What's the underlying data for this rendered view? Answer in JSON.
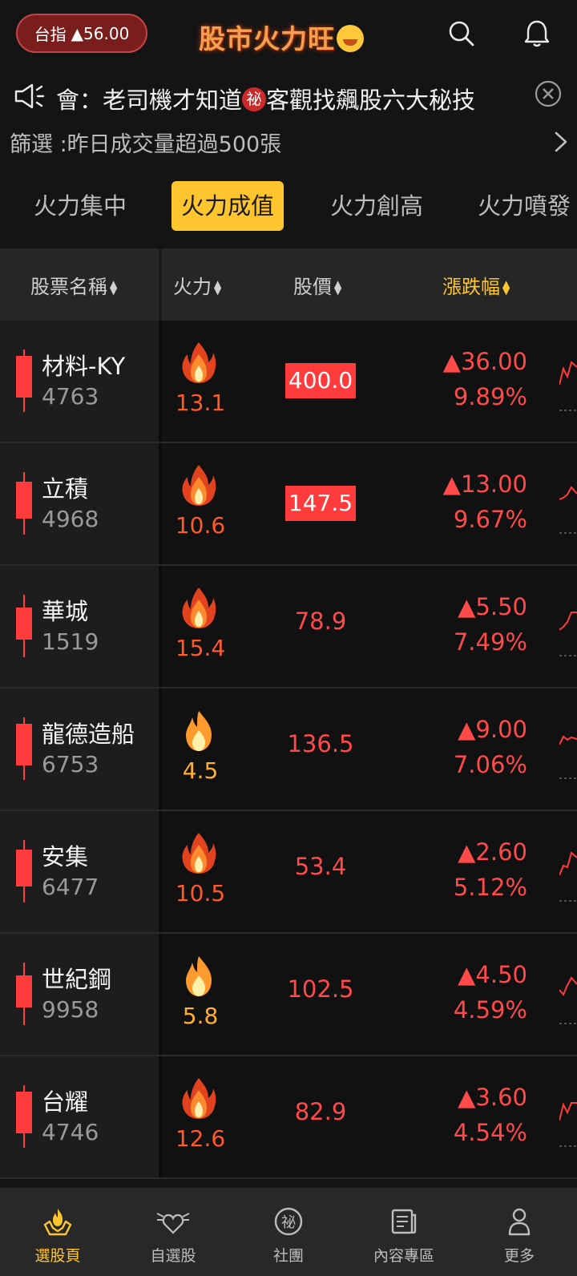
{
  "header": {
    "index_label": "台指",
    "index_change": "▲56.00",
    "app_title": "股市火力旺"
  },
  "announcement": {
    "text_before": "會：老司機才知道",
    "badge": "祕",
    "text_after": "客觀找飆股六大秘技"
  },
  "filter": {
    "text": "篩選 :昨日成交量超過500張"
  },
  "tabs": [
    {
      "label": "火力集中",
      "active": false
    },
    {
      "label": "火力成值",
      "active": true
    },
    {
      "label": "火力創高",
      "active": false
    },
    {
      "label": "火力噴發",
      "active": false
    }
  ],
  "table": {
    "headers": {
      "name": "股票名稱",
      "fire": "火力",
      "price": "股價",
      "change": "漲跌幅"
    },
    "rows": [
      {
        "name": "材料-KY",
        "code": "4763",
        "fire": "13.1",
        "price": "400.0",
        "limit_up": true,
        "change": "▲36.00",
        "pct": "9.89%"
      },
      {
        "name": "立積",
        "code": "4968",
        "fire": "10.6",
        "price": "147.5",
        "limit_up": true,
        "change": "▲13.00",
        "pct": "9.67%"
      },
      {
        "name": "華城",
        "code": "1519",
        "fire": "15.4",
        "price": "78.9",
        "limit_up": false,
        "change": "▲5.50",
        "pct": "7.49%"
      },
      {
        "name": "龍德造船",
        "code": "6753",
        "fire": "4.5",
        "price": "136.5",
        "limit_up": false,
        "change": "▲9.00",
        "pct": "7.06%"
      },
      {
        "name": "安集",
        "code": "6477",
        "fire": "10.5",
        "price": "53.4",
        "limit_up": false,
        "change": "▲2.60",
        "pct": "5.12%"
      },
      {
        "name": "世紀鋼",
        "code": "9958",
        "fire": "5.8",
        "price": "102.5",
        "limit_up": false,
        "change": "▲4.50",
        "pct": "4.59%"
      },
      {
        "name": "台耀",
        "code": "4746",
        "fire": "12.6",
        "price": "82.9",
        "limit_up": false,
        "change": "▲3.60",
        "pct": "4.54%"
      }
    ]
  },
  "bottom_nav": [
    {
      "label": "選股頁",
      "icon": "hand-flame-icon",
      "active": true
    },
    {
      "label": "自選股",
      "icon": "winged-heart-icon",
      "active": false
    },
    {
      "label": "社團",
      "icon": "secret-circle-icon",
      "active": false
    },
    {
      "label": "內容專區",
      "icon": "newspaper-icon",
      "active": false
    },
    {
      "label": "更多",
      "icon": "person-icon",
      "active": false
    }
  ],
  "colors": {
    "accent": "#ffc52e",
    "up": "#ff4a4a",
    "background": "#141414"
  }
}
